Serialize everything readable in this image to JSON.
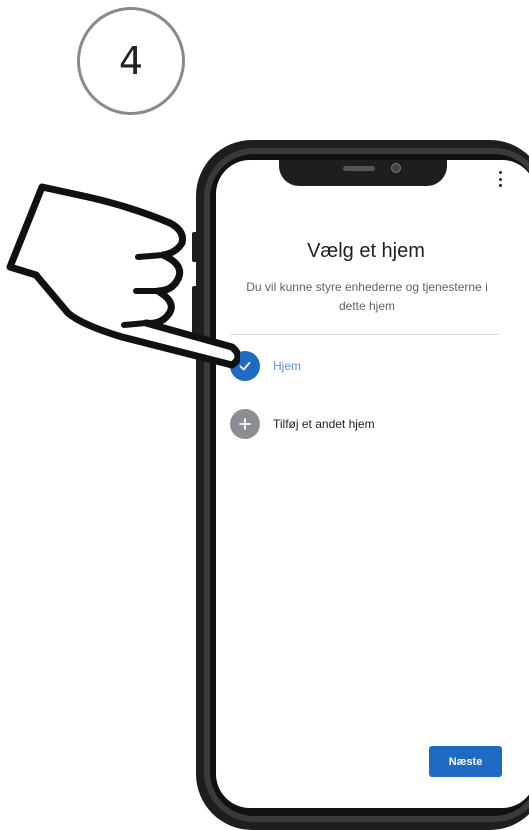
{
  "step": {
    "number": "4"
  },
  "screen": {
    "title": "Vælg et hjem",
    "subtitle": "Du vil kunne styre enhederne og tjenesterne i dette hjem",
    "options": [
      {
        "label": "Hjem",
        "icon": "check-icon",
        "selected": true
      },
      {
        "label": "Tilføj et andet hjem",
        "icon": "plus-icon",
        "selected": false
      }
    ],
    "next_label": "Næste",
    "menu_icon": "more-vert-icon"
  },
  "colors": {
    "accent": "#1f6bc4",
    "add_icon": "#8a8d91",
    "phone_body": "#1e1e1e"
  },
  "overlay": {
    "icon": "pointing-hand-icon"
  }
}
